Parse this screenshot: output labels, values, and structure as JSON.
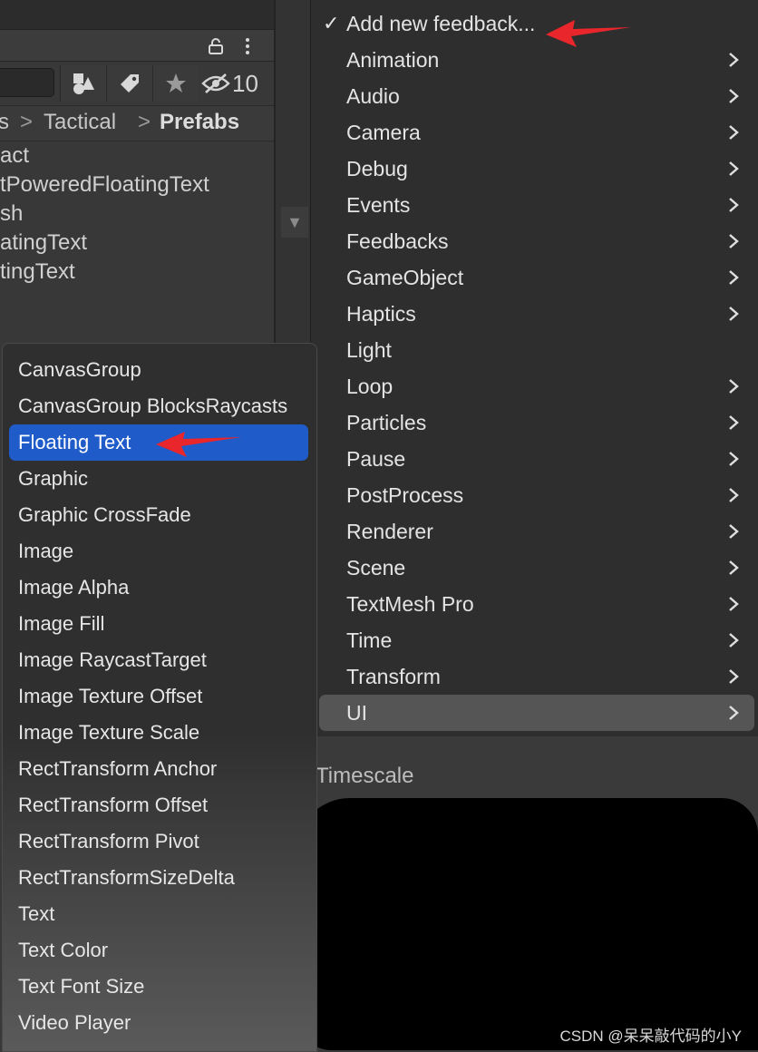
{
  "project_panel": {
    "hidden_count": "10",
    "breadcrumb": [
      "s",
      "Tactical",
      "Prefabs"
    ],
    "breadcrumb_sep": ">",
    "files": [
      "act",
      "tPoweredFloatingText",
      "sh",
      "atingText",
      "tingText"
    ]
  },
  "feedback_menu": {
    "checkmark": "✓",
    "items": [
      {
        "label": "Add new feedback...",
        "has_submenu": false,
        "checked": true
      },
      {
        "label": "Animation",
        "has_submenu": true
      },
      {
        "label": "Audio",
        "has_submenu": true
      },
      {
        "label": "Camera",
        "has_submenu": true
      },
      {
        "label": "Debug",
        "has_submenu": true
      },
      {
        "label": "Events",
        "has_submenu": true
      },
      {
        "label": "Feedbacks",
        "has_submenu": true
      },
      {
        "label": "GameObject",
        "has_submenu": true
      },
      {
        "label": "Haptics",
        "has_submenu": true
      },
      {
        "label": "Light",
        "has_submenu": false
      },
      {
        "label": "Loop",
        "has_submenu": true
      },
      {
        "label": "Particles",
        "has_submenu": true
      },
      {
        "label": "Pause",
        "has_submenu": true
      },
      {
        "label": "PostProcess",
        "has_submenu": true
      },
      {
        "label": "Renderer",
        "has_submenu": true
      },
      {
        "label": "Scene",
        "has_submenu": true
      },
      {
        "label": "TextMesh Pro",
        "has_submenu": true
      },
      {
        "label": "Time",
        "has_submenu": true
      },
      {
        "label": "Transform",
        "has_submenu": true
      },
      {
        "label": "UI",
        "has_submenu": true,
        "selected": true
      }
    ]
  },
  "ui_submenu": {
    "highlight_color": "#1f5bc9",
    "items": [
      {
        "label": "CanvasGroup"
      },
      {
        "label": "CanvasGroup BlocksRaycasts"
      },
      {
        "label": "Floating Text",
        "highlighted": true
      },
      {
        "label": "Graphic"
      },
      {
        "label": "Graphic CrossFade"
      },
      {
        "label": "Image"
      },
      {
        "label": "Image Alpha"
      },
      {
        "label": "Image Fill"
      },
      {
        "label": "Image RaycastTarget"
      },
      {
        "label": "Image Texture Offset"
      },
      {
        "label": "Image Texture Scale"
      },
      {
        "label": "RectTransform Anchor"
      },
      {
        "label": "RectTransform Offset"
      },
      {
        "label": "RectTransform Pivot"
      },
      {
        "label": "RectTransformSizeDelta"
      },
      {
        "label": "Text"
      },
      {
        "label": "Text Color"
      },
      {
        "label": "Text Font Size"
      },
      {
        "label": "Video Player"
      }
    ]
  },
  "inspector": {
    "section_label": "Timescale"
  },
  "annotation_arrow_color": "#e8262b",
  "watermark": "CSDN @呆呆敲代码的小Y"
}
